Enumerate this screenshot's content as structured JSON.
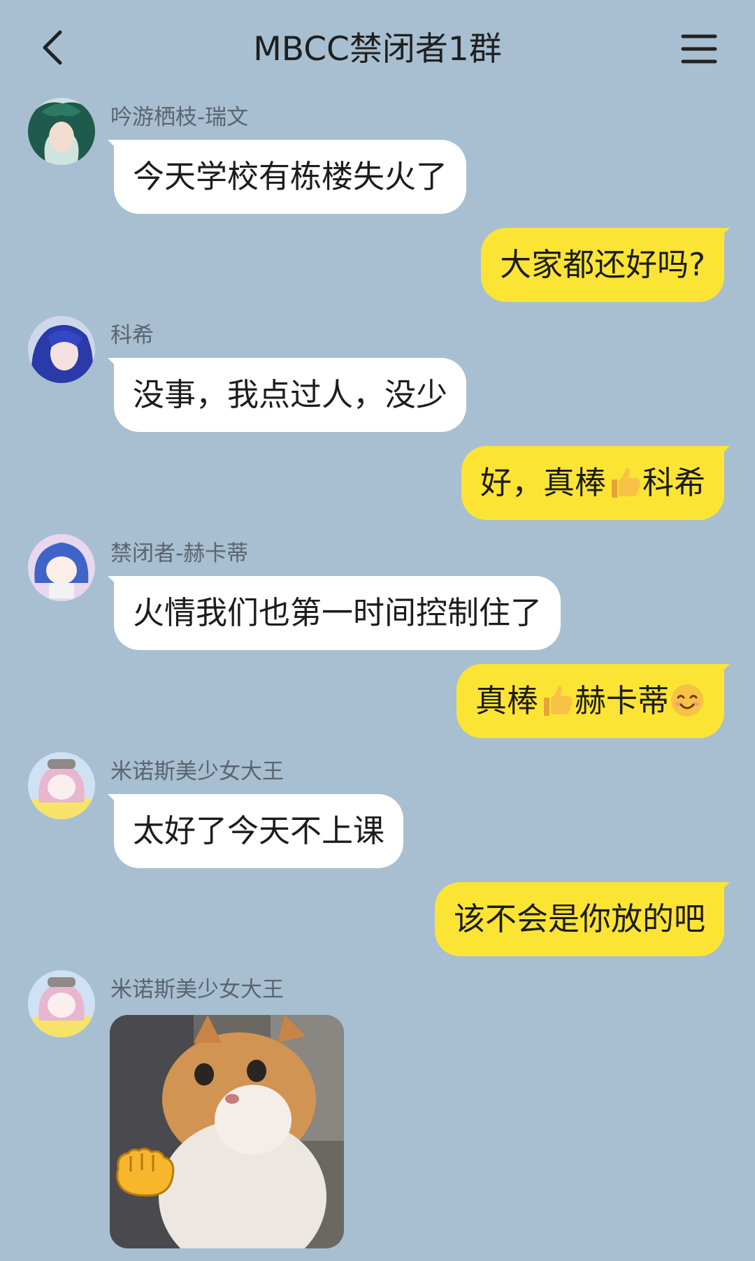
{
  "header": {
    "title": "MBCC禁闭者1群",
    "back_icon": "chevron-left-icon",
    "menu_icon": "hamburger-menu-icon"
  },
  "messages": [
    {
      "side": "left",
      "sender": "吟游栖枝-瑞文",
      "text": "今天学校有栋楼失火了"
    },
    {
      "side": "right",
      "text": "大家都还好吗?"
    },
    {
      "side": "left",
      "sender": "科希",
      "text": "没事，我点过人，没少"
    },
    {
      "side": "right",
      "text_before": "好，真棒",
      "emoji": "thumbs-up-icon",
      "text_after": "科希"
    },
    {
      "side": "left",
      "sender": "禁闭者-赫卡蒂",
      "text": "火情我们也第一时间控制住了"
    },
    {
      "side": "right",
      "text_before": "真棒",
      "emoji": "thumbs-up-icon",
      "text_after": "赫卡蒂",
      "emoji_end": "smiling-face-icon"
    },
    {
      "side": "left",
      "sender": "米诺斯美少女大王",
      "text": "太好了今天不上课"
    },
    {
      "side": "right",
      "text": "该不会是你放的吧"
    },
    {
      "side": "left",
      "sender": "米诺斯美少女大王",
      "sticker": "cat-punch-sticker"
    }
  ],
  "colors": {
    "background": "#a7bfd1",
    "bubble_self": "#fce435",
    "bubble_other": "#ffffff",
    "sender_name": "#5b6470"
  }
}
